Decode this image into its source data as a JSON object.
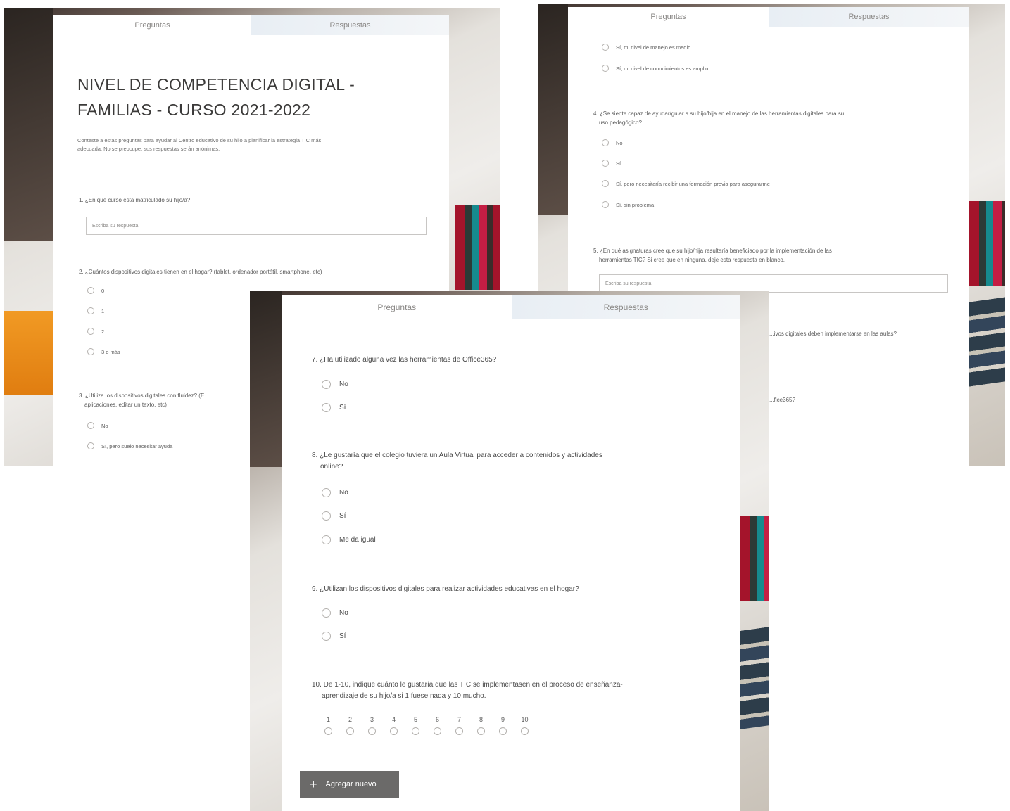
{
  "tabs": {
    "questions": "Preguntas",
    "responses": "Respuestas"
  },
  "form_title_line1": "NIVEL DE COMPETENCIA DIGITAL -",
  "form_title_line2": "FAMILIAS - CURSO 2021-2022",
  "description_line1": "Conteste a estas preguntas para ayudar al Centro educativo de su hijo a planificar la estrategia TIC más",
  "description_line2": "adecuada. No se preocupe: sus respuestas serán anónimas.",
  "answer_placeholder": "Escriba su respuesta",
  "q1": "1. ¿En qué curso está matriculado su hijo/a?",
  "q2": "2. ¿Cuántos dispositivos digitales tienen en el hogar? (tablet, ordenador portátil, smartphone, etc)",
  "q2_options": [
    "0",
    "1",
    "2",
    "3 o más"
  ],
  "q3_line1": "3. ¿Utiliza los dispositivos digitales con fluidez? (E",
  "q3_line2": "aplicaciones, editar un texto, etc)",
  "q3_options": [
    "No",
    "Sí, pero suelo necesitar ayuda"
  ],
  "q3_cont_options": [
    "Sí, mi nivel de manejo es medio",
    "Sí, mi nivel de conocimientos es amplio"
  ],
  "q4_line1": "4. ¿Se siente capaz de ayudar/guiar a su hijo/hija en el manejo de las herramientas digitales para su",
  "q4_line2": "uso pedagógico?",
  "q4_options": [
    "No",
    "Sí",
    "Sí, pero necesitaría recibir una formación previa para asegurarme",
    "Sí, sin problema"
  ],
  "q5_line1": "5. ¿En qué asignaturas cree que su hijo/hija resultaría beneficiado por la implementación de las",
  "q5_line2": "herramientas TIC? Si cree que en ninguna, deje esta respuesta en blanco.",
  "q6_fragment": "...ivos digitales deben implementarse en las aulas?",
  "q7_fragment": "...fice365?",
  "q7": "7. ¿Ha utilizado alguna vez las herramientas de Office365?",
  "q7_options": [
    "No",
    "Sí"
  ],
  "q8_line1": "8. ¿Le gustaría que el colegio tuviera un Aula Virtual para acceder a contenidos y actividades",
  "q8_line2": "online?",
  "q8_options": [
    "No",
    "Sí",
    "Me da igual"
  ],
  "q9": "9. ¿Utilizan los dispositivos digitales para realizar actividades educativas en el hogar?",
  "q9_options": [
    "No",
    "Sí"
  ],
  "q10_line1": "10. De 1-10, indique cuánto le gustaría que las TIC se implementasen en el proceso de enseñanza-",
  "q10_line2": "aprendizaje de su hijo/a si 1 fuese nada y 10 mucho.",
  "q10_scale": [
    "1",
    "2",
    "3",
    "4",
    "5",
    "6",
    "7",
    "8",
    "9",
    "10"
  ],
  "add_new_label": "Agregar nuevo"
}
